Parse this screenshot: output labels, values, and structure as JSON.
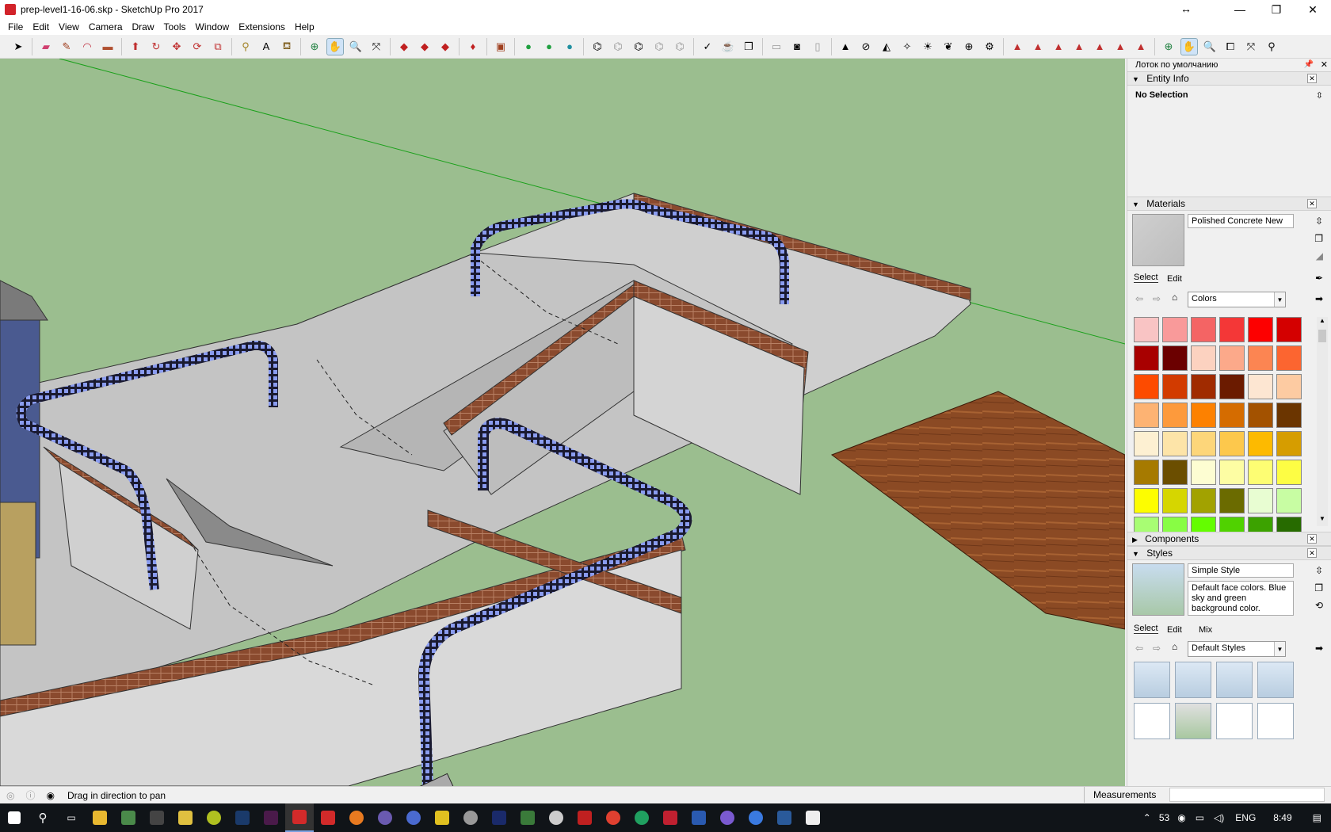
{
  "window": {
    "title": "prep-level1-16-06.skp - SketchUp Pro 2017",
    "resize_glyph": "↔",
    "minimize": "—",
    "restore": "❐",
    "close": "✕"
  },
  "menu": [
    "File",
    "Edit",
    "View",
    "Camera",
    "Draw",
    "Tools",
    "Window",
    "Extensions",
    "Help"
  ],
  "tray": {
    "title": "Лоток по умолчанию",
    "entity_info": {
      "header": "Entity Info",
      "selection": "No Selection"
    },
    "materials": {
      "header": "Materials",
      "name": "Polished Concrete New",
      "tab_select": "Select",
      "tab_edit": "Edit",
      "library": "Colors",
      "swatches": [
        "#f9c4c4",
        "#f99a9a",
        "#f46464",
        "#f43737",
        "#fd0000",
        "#d40000",
        "#a80000",
        "#6b0000",
        "#fcd2c0",
        "#fca98a",
        "#fc8552",
        "#fc6530",
        "#fd4b00",
        "#d23b00",
        "#a02b00",
        "#6b1b00",
        "#fde6d2",
        "#fdcba2",
        "#fdb373",
        "#fd9a3c",
        "#fd8100",
        "#d56c00",
        "#a35200",
        "#6b3500",
        "#fdf0d2",
        "#fde4a8",
        "#fdd67a",
        "#fdc84c",
        "#fdba00",
        "#d69d00",
        "#a67a00",
        "#6b4e00",
        "#fdfdd2",
        "#fdfda3",
        "#fdfd73",
        "#fdfd44",
        "#fdfd00",
        "#d6d600",
        "#a2a200",
        "#6b6b00",
        "#e8fdd2",
        "#c8fda3",
        "#a8fd73",
        "#88fd44",
        "#64fd00",
        "#50d200",
        "#3ca200",
        "#276b00"
      ]
    },
    "components": {
      "header": "Components"
    },
    "styles": {
      "header": "Styles",
      "name": "Simple Style",
      "description": "Default face colors. Blue sky and green background color.",
      "tab_select": "Select",
      "tab_edit": "Edit",
      "tab_mix": "Mix",
      "library": "Default Styles"
    }
  },
  "status": {
    "message": "Drag in direction to pan",
    "measurements_label": "Measurements",
    "measurements_value": ""
  },
  "taskbar": {
    "tray_labels": [
      "ENG"
    ],
    "time": "8:49",
    "battery": "53"
  },
  "colors": {
    "sky_ground": "#9bbe8f",
    "concrete": "#c9c9c9",
    "brick": "#8a4a2e",
    "rail": "#5566c8",
    "wood": "#8b4a24"
  }
}
